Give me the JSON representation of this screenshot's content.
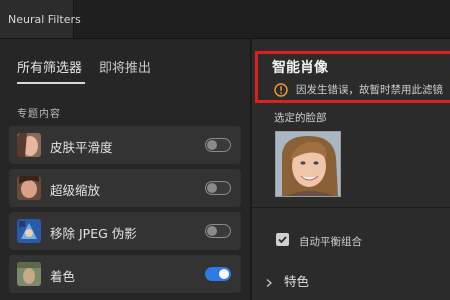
{
  "tab": {
    "label": "Neural Filters"
  },
  "segments": [
    {
      "label": "所有筛选器"
    },
    {
      "label": "即将推出"
    }
  ],
  "section_title": "专题内容",
  "filters": [
    {
      "label": "皮肤平滑度",
      "icon": "skin-smoothing-thumbnail",
      "enabled": false
    },
    {
      "label": "超级缩放",
      "icon": "super-zoom-thumbnail",
      "enabled": false
    },
    {
      "label": "移除 JPEG 伪影",
      "icon": "jpeg-artifact-thumbnail",
      "enabled": false
    },
    {
      "label": "着色",
      "icon": "colorize-thumbnail",
      "enabled": true
    }
  ],
  "detail": {
    "title": "智能肖像",
    "warning": "因发生错误，故暂时禁用此滤镜",
    "warning_icon": "warning-icon",
    "face_label": "选定的脸部",
    "checkbox_label": "自动平衡组合",
    "checkbox_checked": true,
    "expand_label": "特色"
  },
  "colors": {
    "accent": "#2c7be5",
    "error_outline": "#e01e1e",
    "warning": "#f0a030"
  }
}
